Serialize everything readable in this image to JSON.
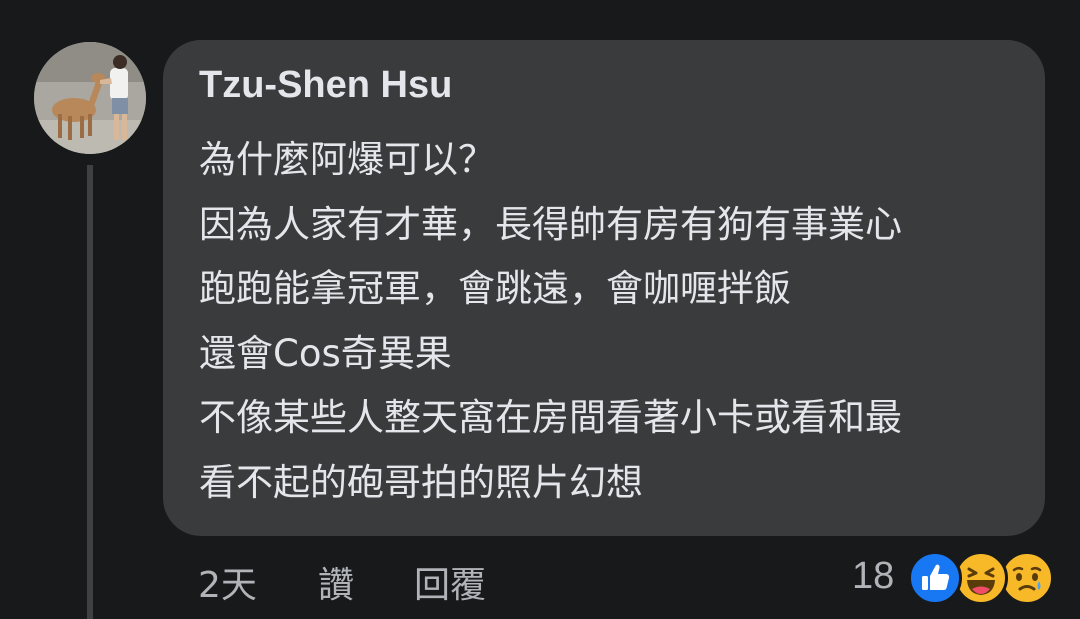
{
  "comment": {
    "author": "Tzu-Shen Hsu",
    "lines": [
      "為什麼阿爆可以？",
      "因為人家有才華，長得帥有房有狗有事業心",
      "跑跑能拿冠軍，會跳遠，會咖喱拌飯",
      "還會Cos奇異果",
      "不像某些人整天窩在房間看著小卡或看和最",
      "看不起的砲哥拍的照片幻想"
    ],
    "time": "2天",
    "like_label": "讚",
    "reply_label": "回覆",
    "reaction_count": "18",
    "reactions": [
      "like-icon",
      "haha-icon",
      "sad-icon"
    ]
  },
  "colors": {
    "background": "#18191a",
    "bubble": "#3a3b3c",
    "text": "#e4e6eb",
    "secondary_text": "#b0b3b8",
    "like_blue": "#1877f2",
    "emoji_yellow": "#f7b928"
  }
}
